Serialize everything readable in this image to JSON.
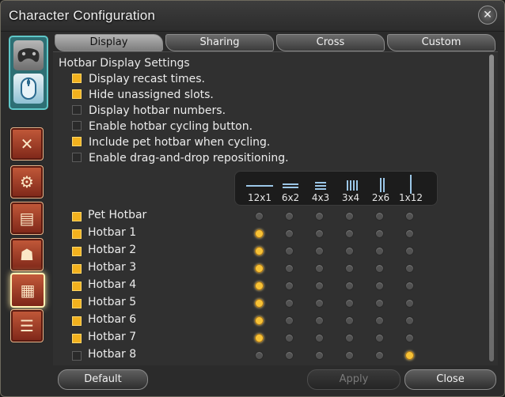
{
  "window": {
    "title": "Character Configuration"
  },
  "tabs": [
    "Display",
    "Sharing",
    "Cross",
    "Custom"
  ],
  "active_tab": "Display",
  "section": {
    "title": "Hotbar Display Settings"
  },
  "options": [
    {
      "label": "Display recast times.",
      "checked": true
    },
    {
      "label": "Hide unassigned slots.",
      "checked": true
    },
    {
      "label": "Display hotbar numbers.",
      "checked": false
    },
    {
      "label": "Enable hotbar cycling button.",
      "checked": false
    },
    {
      "label": "Include pet hotbar when cycling.",
      "checked": true
    },
    {
      "label": "Enable drag-and-drop repositioning.",
      "checked": false
    }
  ],
  "layouts": [
    "12x1",
    "6x2",
    "4x3",
    "3x4",
    "2x6",
    "1x12"
  ],
  "hotbars": [
    {
      "label": "Pet Hotbar",
      "checked": true,
      "layout": null
    },
    {
      "label": "Hotbar 1",
      "checked": true,
      "layout": "12x1"
    },
    {
      "label": "Hotbar 2",
      "checked": true,
      "layout": "12x1"
    },
    {
      "label": "Hotbar 3",
      "checked": true,
      "layout": "12x1"
    },
    {
      "label": "Hotbar 4",
      "checked": true,
      "layout": "12x1"
    },
    {
      "label": "Hotbar 5",
      "checked": true,
      "layout": "12x1"
    },
    {
      "label": "Hotbar 6",
      "checked": true,
      "layout": "12x1"
    },
    {
      "label": "Hotbar 7",
      "checked": true,
      "layout": "12x1"
    },
    {
      "label": "Hotbar 8",
      "checked": false,
      "layout": "1x12"
    }
  ],
  "buttons": {
    "default": "Default",
    "apply": "Apply",
    "close": "Close"
  },
  "icons": {
    "close": "close-icon",
    "gamepad": "gamepad-icon",
    "mouse": "mouse-icon",
    "sidebar": [
      "crossed-swords-icon",
      "gear-bag-icon",
      "id-card-icon",
      "character-icon",
      "hotbar-grid-icon",
      "chat-bubble-icon"
    ]
  },
  "colors": {
    "accent": "#f2b11e",
    "teal": "#5fc7c8",
    "icon_red": "#c35a3a"
  }
}
